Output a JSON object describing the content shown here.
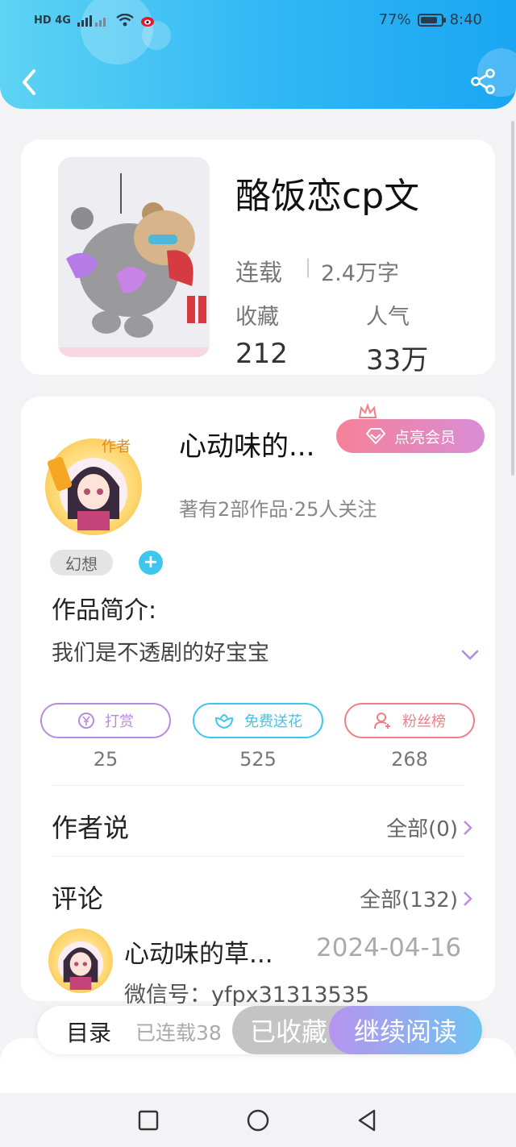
{
  "status_bar": {
    "network": "HD 4G",
    "battery": "77%",
    "time": "8:40"
  },
  "header": {
    "back_icon": "chevron-left-icon",
    "share_icon": "share-icon"
  },
  "book": {
    "title": "酪饭恋cp文",
    "status": "连载",
    "word_count": "2.4万字",
    "favorites_label": "收藏",
    "favorites_value": "212",
    "popularity_label": "人气",
    "popularity_value": "33万"
  },
  "author": {
    "name": "心动味的...",
    "stats": "著有2部作品·25人关注",
    "vip_button": "点亮会员",
    "badge": "作者"
  },
  "tags": {
    "genre": "幻想",
    "add": "+"
  },
  "intro": {
    "label": "作品简介:",
    "text": "我们是不透剧的好宝宝"
  },
  "actions": [
    {
      "label": "打赏",
      "count": "25",
      "color": "#b98be0",
      "icon": "yen-coin-icon"
    },
    {
      "label": "免费送花",
      "count": "525",
      "color": "#3ec6ec",
      "icon": "flower-icon"
    },
    {
      "label": "粉丝榜",
      "count": "268",
      "color": "#ef7f86",
      "icon": "fan-user-icon"
    }
  ],
  "author_says": {
    "title": "作者说",
    "link": "全部(0)"
  },
  "comments": {
    "title": "评论",
    "link": "全部(132)",
    "items": [
      {
        "user": "心动味的草...",
        "date": "2024-04-16",
        "text": "微信号：yfpx31313535"
      }
    ]
  },
  "bottom_bar": {
    "toc_label": "目录",
    "toc_sub": "已连载38",
    "favorited_label": "已收藏",
    "continue_label": "继续阅读"
  },
  "nav": {
    "recent_icon": "square-recents-icon",
    "home_icon": "circle-home-icon",
    "back_icon": "triangle-back-icon"
  }
}
